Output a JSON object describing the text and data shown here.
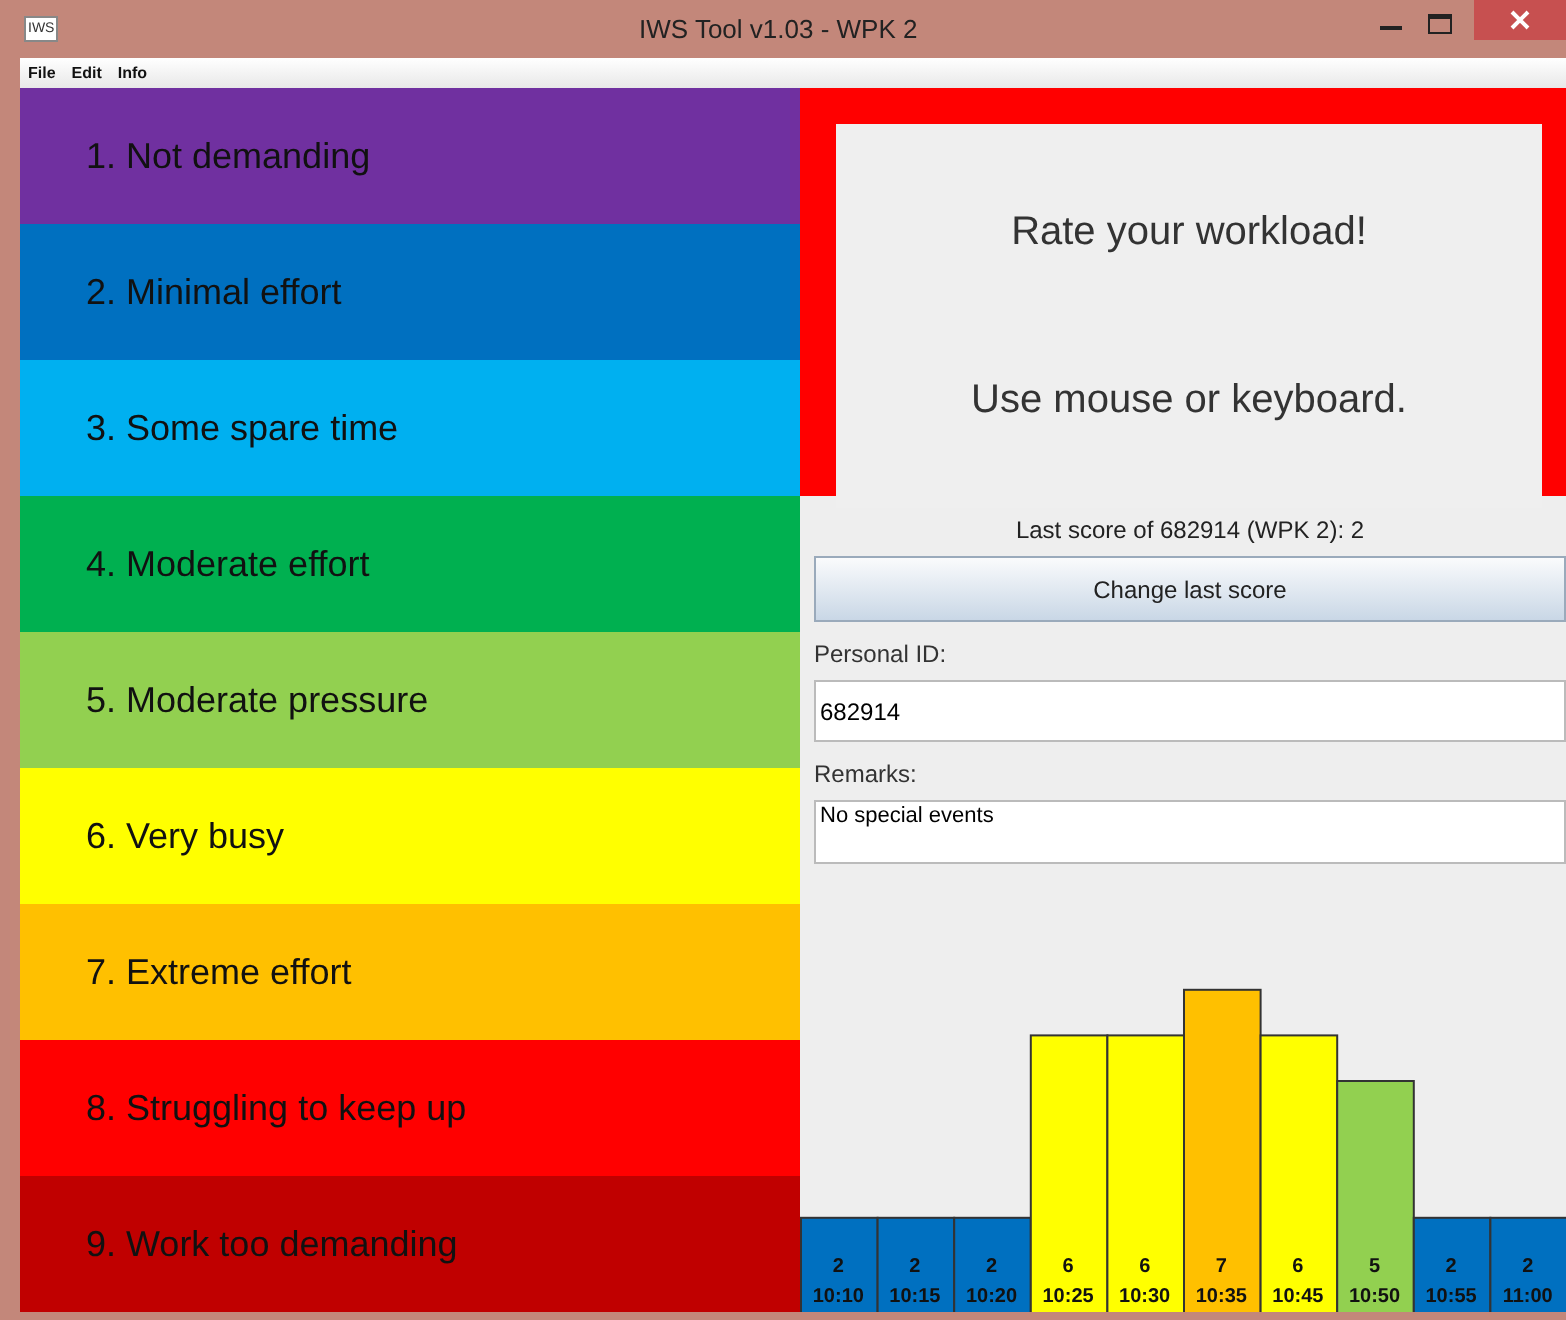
{
  "window": {
    "title": "IWS Tool v1.03 - WPK 2",
    "app_icon": "IWS"
  },
  "menu": [
    "File",
    "Edit",
    "Info"
  ],
  "ratings": [
    {
      "label": "1. Not demanding",
      "color": "#7030a0"
    },
    {
      "label": "2. Minimal effort",
      "color": "#0070c0"
    },
    {
      "label": "3. Some spare time",
      "color": "#00b0f0"
    },
    {
      "label": "4. Moderate effort",
      "color": "#00b050"
    },
    {
      "label": "5. Moderate pressure",
      "color": "#92d050"
    },
    {
      "label": "6. Very busy",
      "color": "#ffff00"
    },
    {
      "label": "7. Extreme effort",
      "color": "#ffc000"
    },
    {
      "label": "8. Struggling to keep up",
      "color": "#ff0000"
    },
    {
      "label": "9. Work too demanding",
      "color": "#c00000"
    }
  ],
  "prompt": {
    "lines": [
      "Rate your workload!",
      "Use mouse or keyboard."
    ],
    "alert": true
  },
  "last_score": "Last score of 682914 (WPK 2): 2",
  "change_button": "Change last score",
  "personal_id": {
    "label": "Personal ID:",
    "value": "682914"
  },
  "remarks": {
    "label": "Remarks:",
    "value": "No special events"
  },
  "history": {
    "chart_data": {
      "type": "bar",
      "categories": [
        "10:10",
        "10:15",
        "10:20",
        "10:25",
        "10:30",
        "10:35",
        "10:45",
        "10:50",
        "10:55",
        "11:00"
      ],
      "values": [
        2,
        2,
        2,
        6,
        6,
        7,
        6,
        5,
        2,
        2
      ],
      "data_labels": true
    }
  }
}
